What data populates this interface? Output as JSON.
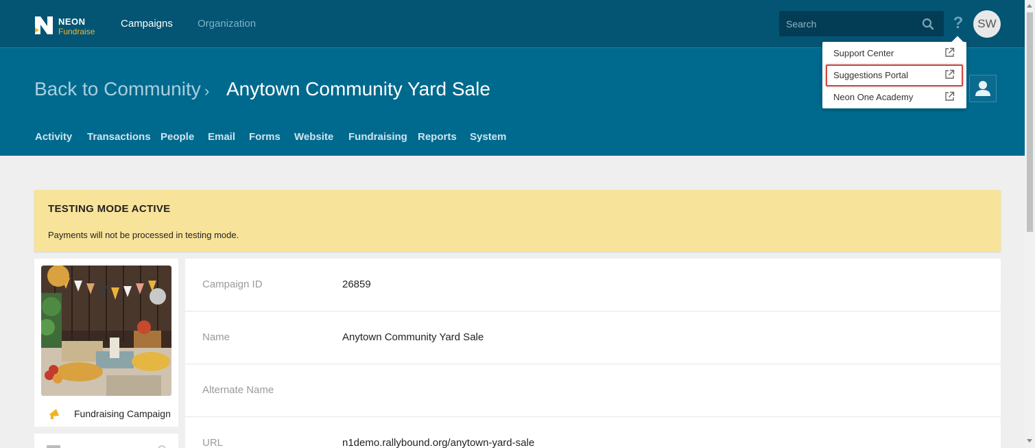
{
  "topbar": {
    "logo_brand": "NEON",
    "logo_sub": "Fundraise",
    "nav": [
      {
        "label": "Campaigns"
      },
      {
        "label": "Organization"
      }
    ],
    "search_placeholder": "Search",
    "help_glyph": "?",
    "avatar_initials": "SW"
  },
  "help_menu": {
    "items": [
      {
        "label": "Support Center",
        "icon": "external-link-icon"
      },
      {
        "label": "Suggestions Portal",
        "icon": "external-link-icon",
        "highlighted": true
      },
      {
        "label": "Neon One Academy",
        "icon": "external-link-icon"
      }
    ]
  },
  "header": {
    "back_label": "Back to Community",
    "separator": "›",
    "title": "Anytown Community Yard Sale",
    "tabs": [
      {
        "label": "Activity"
      },
      {
        "label": "Transactions"
      },
      {
        "label": "People"
      },
      {
        "label": "Email"
      },
      {
        "label": "Forms"
      },
      {
        "label": "Website"
      },
      {
        "label": "Fundraising"
      },
      {
        "label": "Reports"
      },
      {
        "label": "System"
      }
    ]
  },
  "banner": {
    "heading": "TESTING MODE ACTIVE",
    "message": "Payments will not be processed in testing mode.",
    "color": "#f8e39a"
  },
  "campaign_card": {
    "type_label": "Fundraising Campaign",
    "type_icon": "megaphone-icon"
  },
  "details": {
    "rows": [
      {
        "label": "Campaign ID",
        "value": "26859"
      },
      {
        "label": "Name",
        "value": "Anytown Community Yard Sale"
      },
      {
        "label": "Alternate Name",
        "value": ""
      },
      {
        "label": "URL",
        "value": "n1demo.rallybound.org/anytown-yard-sale"
      }
    ]
  },
  "colors": {
    "topbar": "#045473",
    "header": "#006a8e",
    "accent": "#f5b52a",
    "highlight_frame": "#d2463d"
  }
}
